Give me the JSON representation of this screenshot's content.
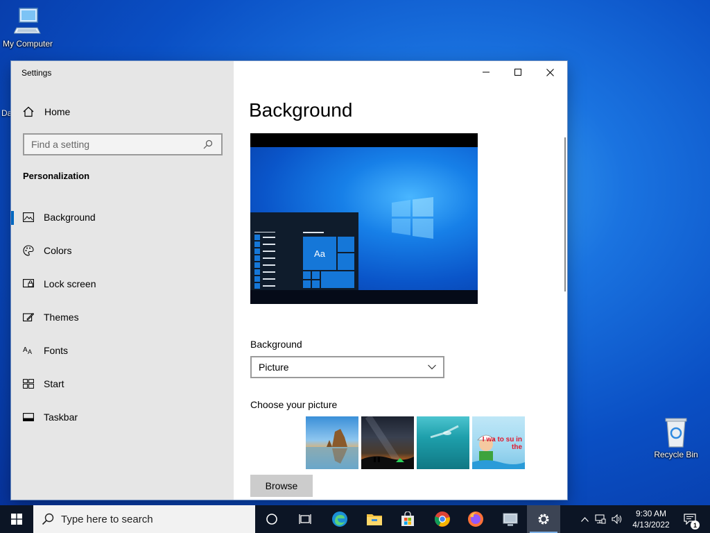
{
  "desktop": {
    "icons": [
      {
        "label": "My Computer"
      },
      {
        "label": "Recycle Bin"
      }
    ],
    "partial_label": "Da"
  },
  "window": {
    "title": "Settings",
    "controls": {
      "minimize": "minimize-icon",
      "maximize": "maximize-icon",
      "close": "close-icon"
    }
  },
  "sidebar": {
    "home_label": "Home",
    "search_placeholder": "Find a setting",
    "section_title": "Personalization",
    "items": [
      {
        "label": "Background",
        "icon": "picture-icon",
        "active": true
      },
      {
        "label": "Colors",
        "icon": "palette-icon",
        "active": false
      },
      {
        "label": "Lock screen",
        "icon": "lock-screen-icon",
        "active": false
      },
      {
        "label": "Themes",
        "icon": "themes-icon",
        "active": false
      },
      {
        "label": "Fonts",
        "icon": "fonts-icon",
        "active": false
      },
      {
        "label": "Start",
        "icon": "start-icon",
        "active": false
      },
      {
        "label": "Taskbar",
        "icon": "taskbar-icon",
        "active": false
      }
    ]
  },
  "content": {
    "page_title": "Background",
    "preview_tile_text": "Aa",
    "background_label": "Background",
    "background_value": "Picture",
    "choose_label": "Choose your picture",
    "thumb4_text": "I wa to su in the",
    "browse_label": "Browse"
  },
  "taskbar": {
    "search_placeholder": "Type here to search",
    "time": "9:30 AM",
    "date": "4/13/2022",
    "notification_count": "1",
    "accent": "#0067c0"
  }
}
